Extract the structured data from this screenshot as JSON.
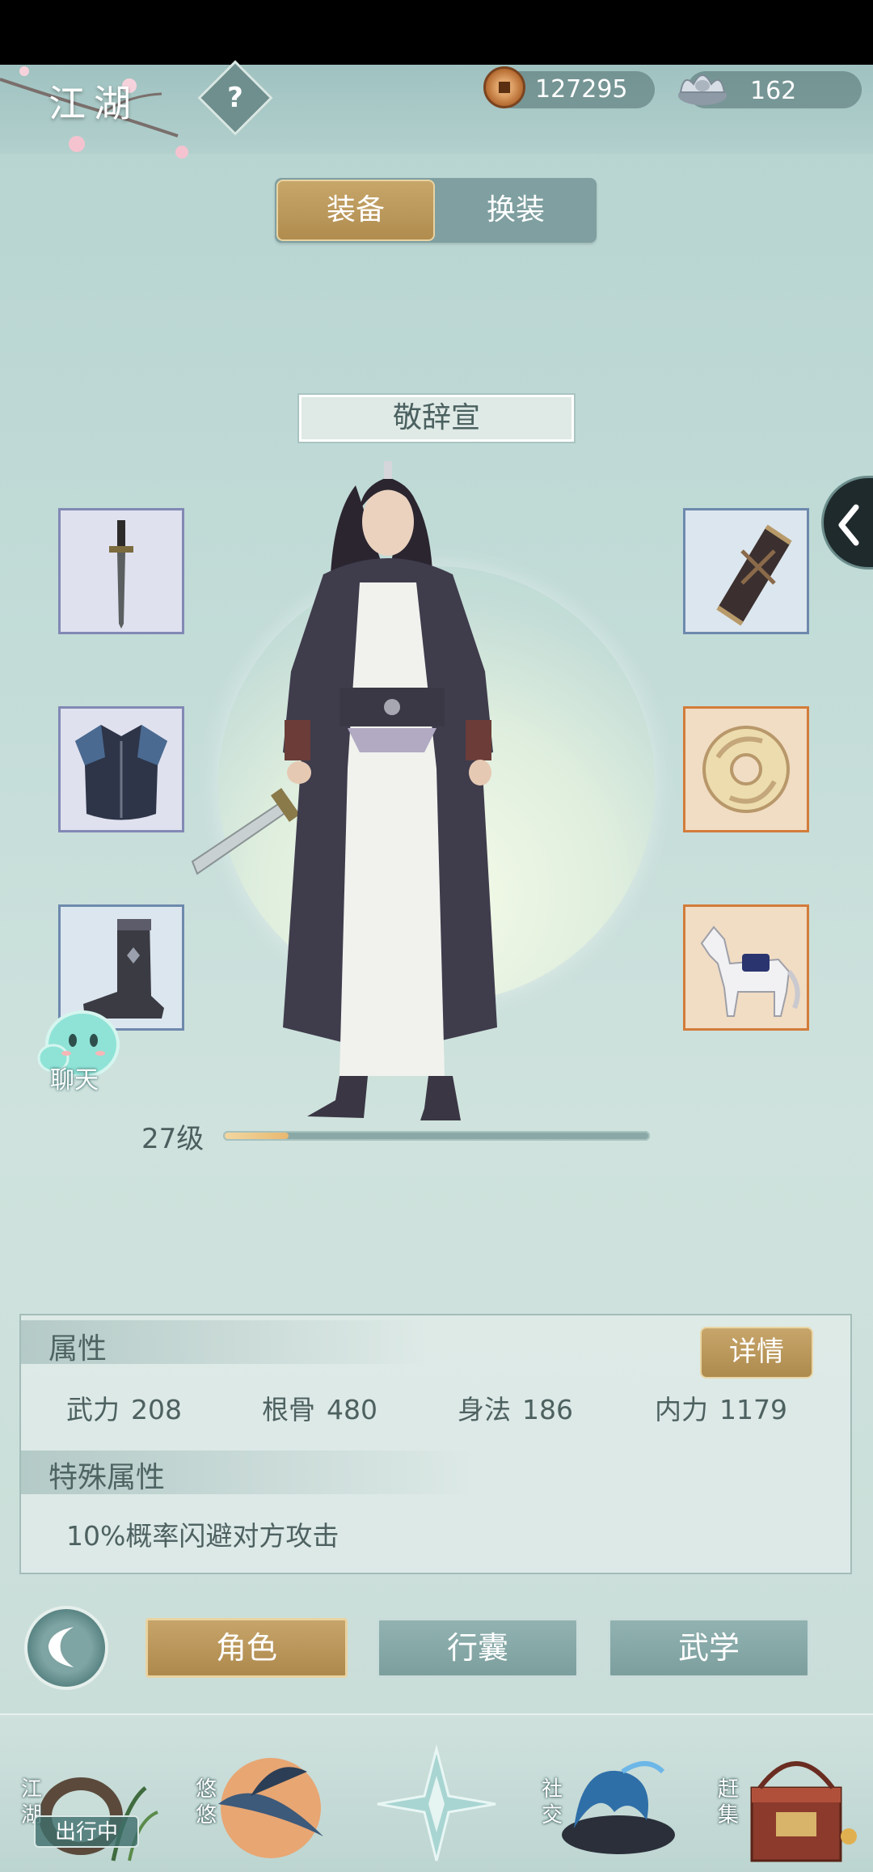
{
  "header": {
    "title": "江湖",
    "help_label": "?",
    "copper": "127295",
    "silver": "162"
  },
  "tabs": [
    {
      "label": "装备",
      "active": true
    },
    {
      "label": "换装",
      "active": false
    }
  ],
  "character": {
    "name": "敬辞宣",
    "level_text": "27级",
    "level_progress": 0.15
  },
  "equipment": {
    "left": [
      "weapon",
      "armor",
      "boots"
    ],
    "right": [
      "bracer",
      "jade-pendant",
      "horse"
    ]
  },
  "chat_label": "聊天",
  "attributes": {
    "title": "属性",
    "detail_label": "详情",
    "stats": [
      {
        "name": "武力",
        "value": "208"
      },
      {
        "name": "根骨",
        "value": "480"
      },
      {
        "name": "身法",
        "value": "186"
      },
      {
        "name": "内力",
        "value": "1179"
      }
    ],
    "special_title": "特殊属性",
    "special_text": "10%概率闪避对方攻击"
  },
  "menu": {
    "items": [
      {
        "label": "角色",
        "active": true
      },
      {
        "label": "行囊",
        "active": false
      },
      {
        "label": "武学",
        "active": false
      }
    ]
  },
  "bottom_nav": {
    "items": [
      {
        "label": "江湖"
      },
      {
        "label": "悠悠"
      },
      {
        "label": ""
      },
      {
        "label": "社交"
      },
      {
        "label": "赶集"
      }
    ],
    "status": "出行中"
  },
  "colors": {
    "gold_accent": "#b8965a",
    "teal_bg": "#bcd6d2",
    "slot_orange": "#d37c3a",
    "slot_blue": "#8289b5"
  }
}
